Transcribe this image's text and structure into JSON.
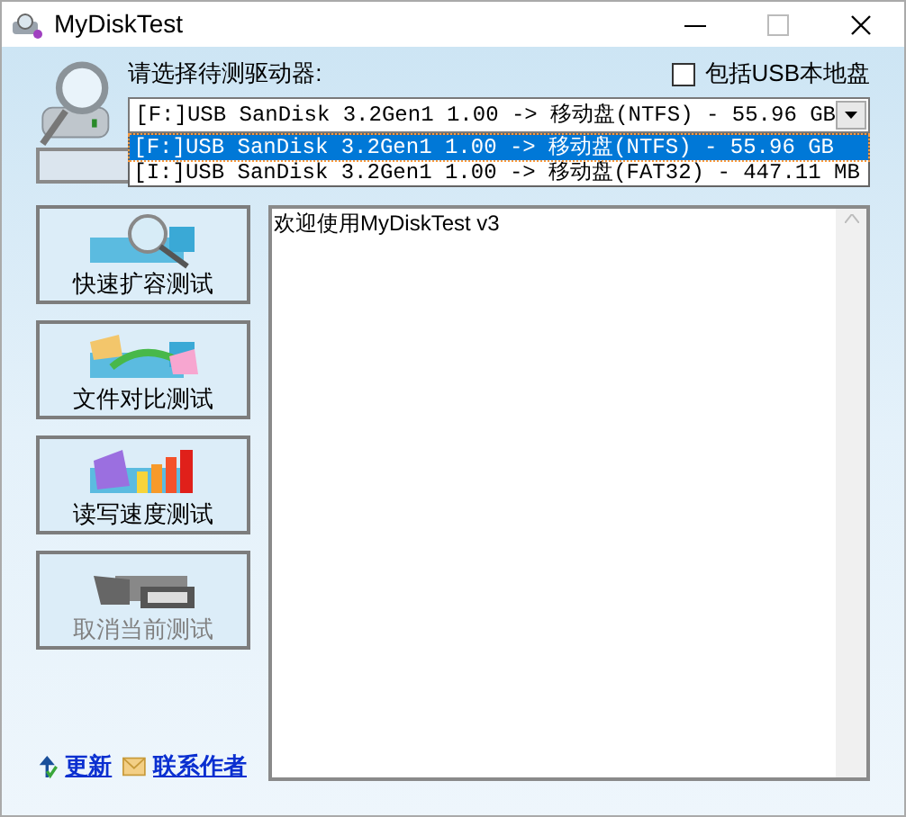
{
  "window": {
    "title": "MyDiskTest"
  },
  "drive_label": "请选择待测驱动器:",
  "include_usb_local": {
    "label": "包括USB本地盘",
    "checked": false
  },
  "drive_select": {
    "value": "[F:]USB SanDisk 3.2Gen1 1.00 -> 移动盘(NTFS) - 55.96 GB",
    "expanded": true,
    "options": [
      {
        "label": "[F:]USB SanDisk 3.2Gen1 1.00 -> 移动盘(NTFS) - 55.96 GB",
        "selected": true
      },
      {
        "label": "[I:]USB SanDisk 3.2Gen1 1.00 -> 移动盘(FAT32) - 447.11 MB",
        "selected": false
      }
    ]
  },
  "test_buttons": [
    {
      "label": "快速扩容测试",
      "kind": "magnifier",
      "disabled": false
    },
    {
      "label": "文件对比测试",
      "kind": "compare",
      "disabled": false
    },
    {
      "label": "读写速度测试",
      "kind": "speed",
      "disabled": false
    },
    {
      "label": "取消当前测试",
      "kind": "stop",
      "disabled": true
    }
  ],
  "links": [
    {
      "label": "更新",
      "kind": "update"
    },
    {
      "label": "联系作者",
      "kind": "mail"
    }
  ],
  "log": {
    "text": "欢迎使用MyDiskTest v3"
  }
}
